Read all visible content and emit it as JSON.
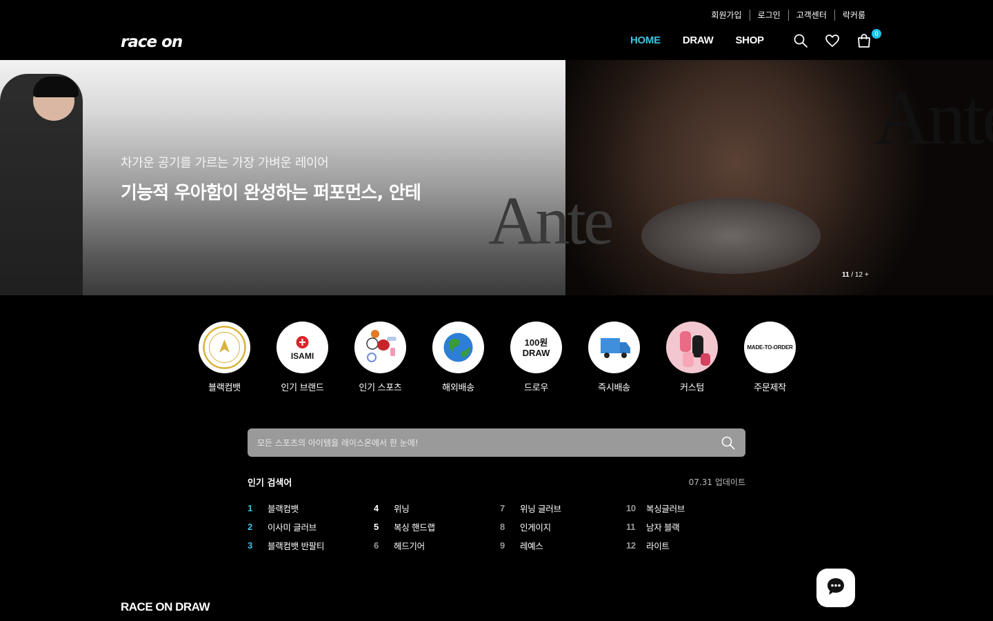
{
  "header": {
    "util_links": [
      "회원가입",
      "로그인",
      "고객센터",
      "락커룸"
    ],
    "logo": "race on",
    "nav": [
      "HOME",
      "DRAW",
      "SHOP"
    ],
    "cart_count": "0",
    "accent_color": "#3cc3e8"
  },
  "hero": {
    "subtitle": "차가운 공기를 가르는 가장 가벼운 레이어",
    "title": "기능적 우아함이 완성하는 퍼포먼스, 안테",
    "brand_word_large": "Ante",
    "brand_word_small": "Ante",
    "counter_current": "11",
    "counter_rest": " / 12 +"
  },
  "categories": [
    {
      "label": "블랙컴뱃",
      "icon": "black-combat-logo"
    },
    {
      "label": "인기 브랜드",
      "icon": "isami-logo",
      "text": "ISAMI"
    },
    {
      "label": "인기 스포츠",
      "icon": "sports-equipment-icon"
    },
    {
      "label": "해외배송",
      "icon": "globe-icon"
    },
    {
      "label": "드로우",
      "icon": "draw-icon",
      "text_line1": "100원",
      "text_line2": "DRAW"
    },
    {
      "label": "즉시배송",
      "icon": "truck-icon"
    },
    {
      "label": "커스텀",
      "icon": "custom-gloves-icon"
    },
    {
      "label": "주문제작",
      "icon": "made-to-order-icon",
      "text": "MADE-TO-ORDER"
    }
  ],
  "search": {
    "placeholder": "모든 스포츠의 아이템을 레이스온에서 한 눈에!"
  },
  "popular": {
    "title": "인기 검색어",
    "updated": "07.31 업데이트",
    "items": [
      {
        "rank": "1",
        "term": "블랙컴뱃"
      },
      {
        "rank": "4",
        "term": "위닝"
      },
      {
        "rank": "7",
        "term": "위닝 글러브"
      },
      {
        "rank": "10",
        "term": "복싱글러브"
      },
      {
        "rank": "2",
        "term": "이사미 글러브"
      },
      {
        "rank": "5",
        "term": "복싱 핸드랩"
      },
      {
        "rank": "8",
        "term": "인게이지"
      },
      {
        "rank": "11",
        "term": "남자 블랙"
      },
      {
        "rank": "3",
        "term": "블랙컴뱃 반팔티"
      },
      {
        "rank": "6",
        "term": "헤드기어"
      },
      {
        "rank": "9",
        "term": "레예스"
      },
      {
        "rank": "12",
        "term": "라이트"
      }
    ]
  },
  "draw_section": {
    "title": "RACE ON DRAW"
  }
}
